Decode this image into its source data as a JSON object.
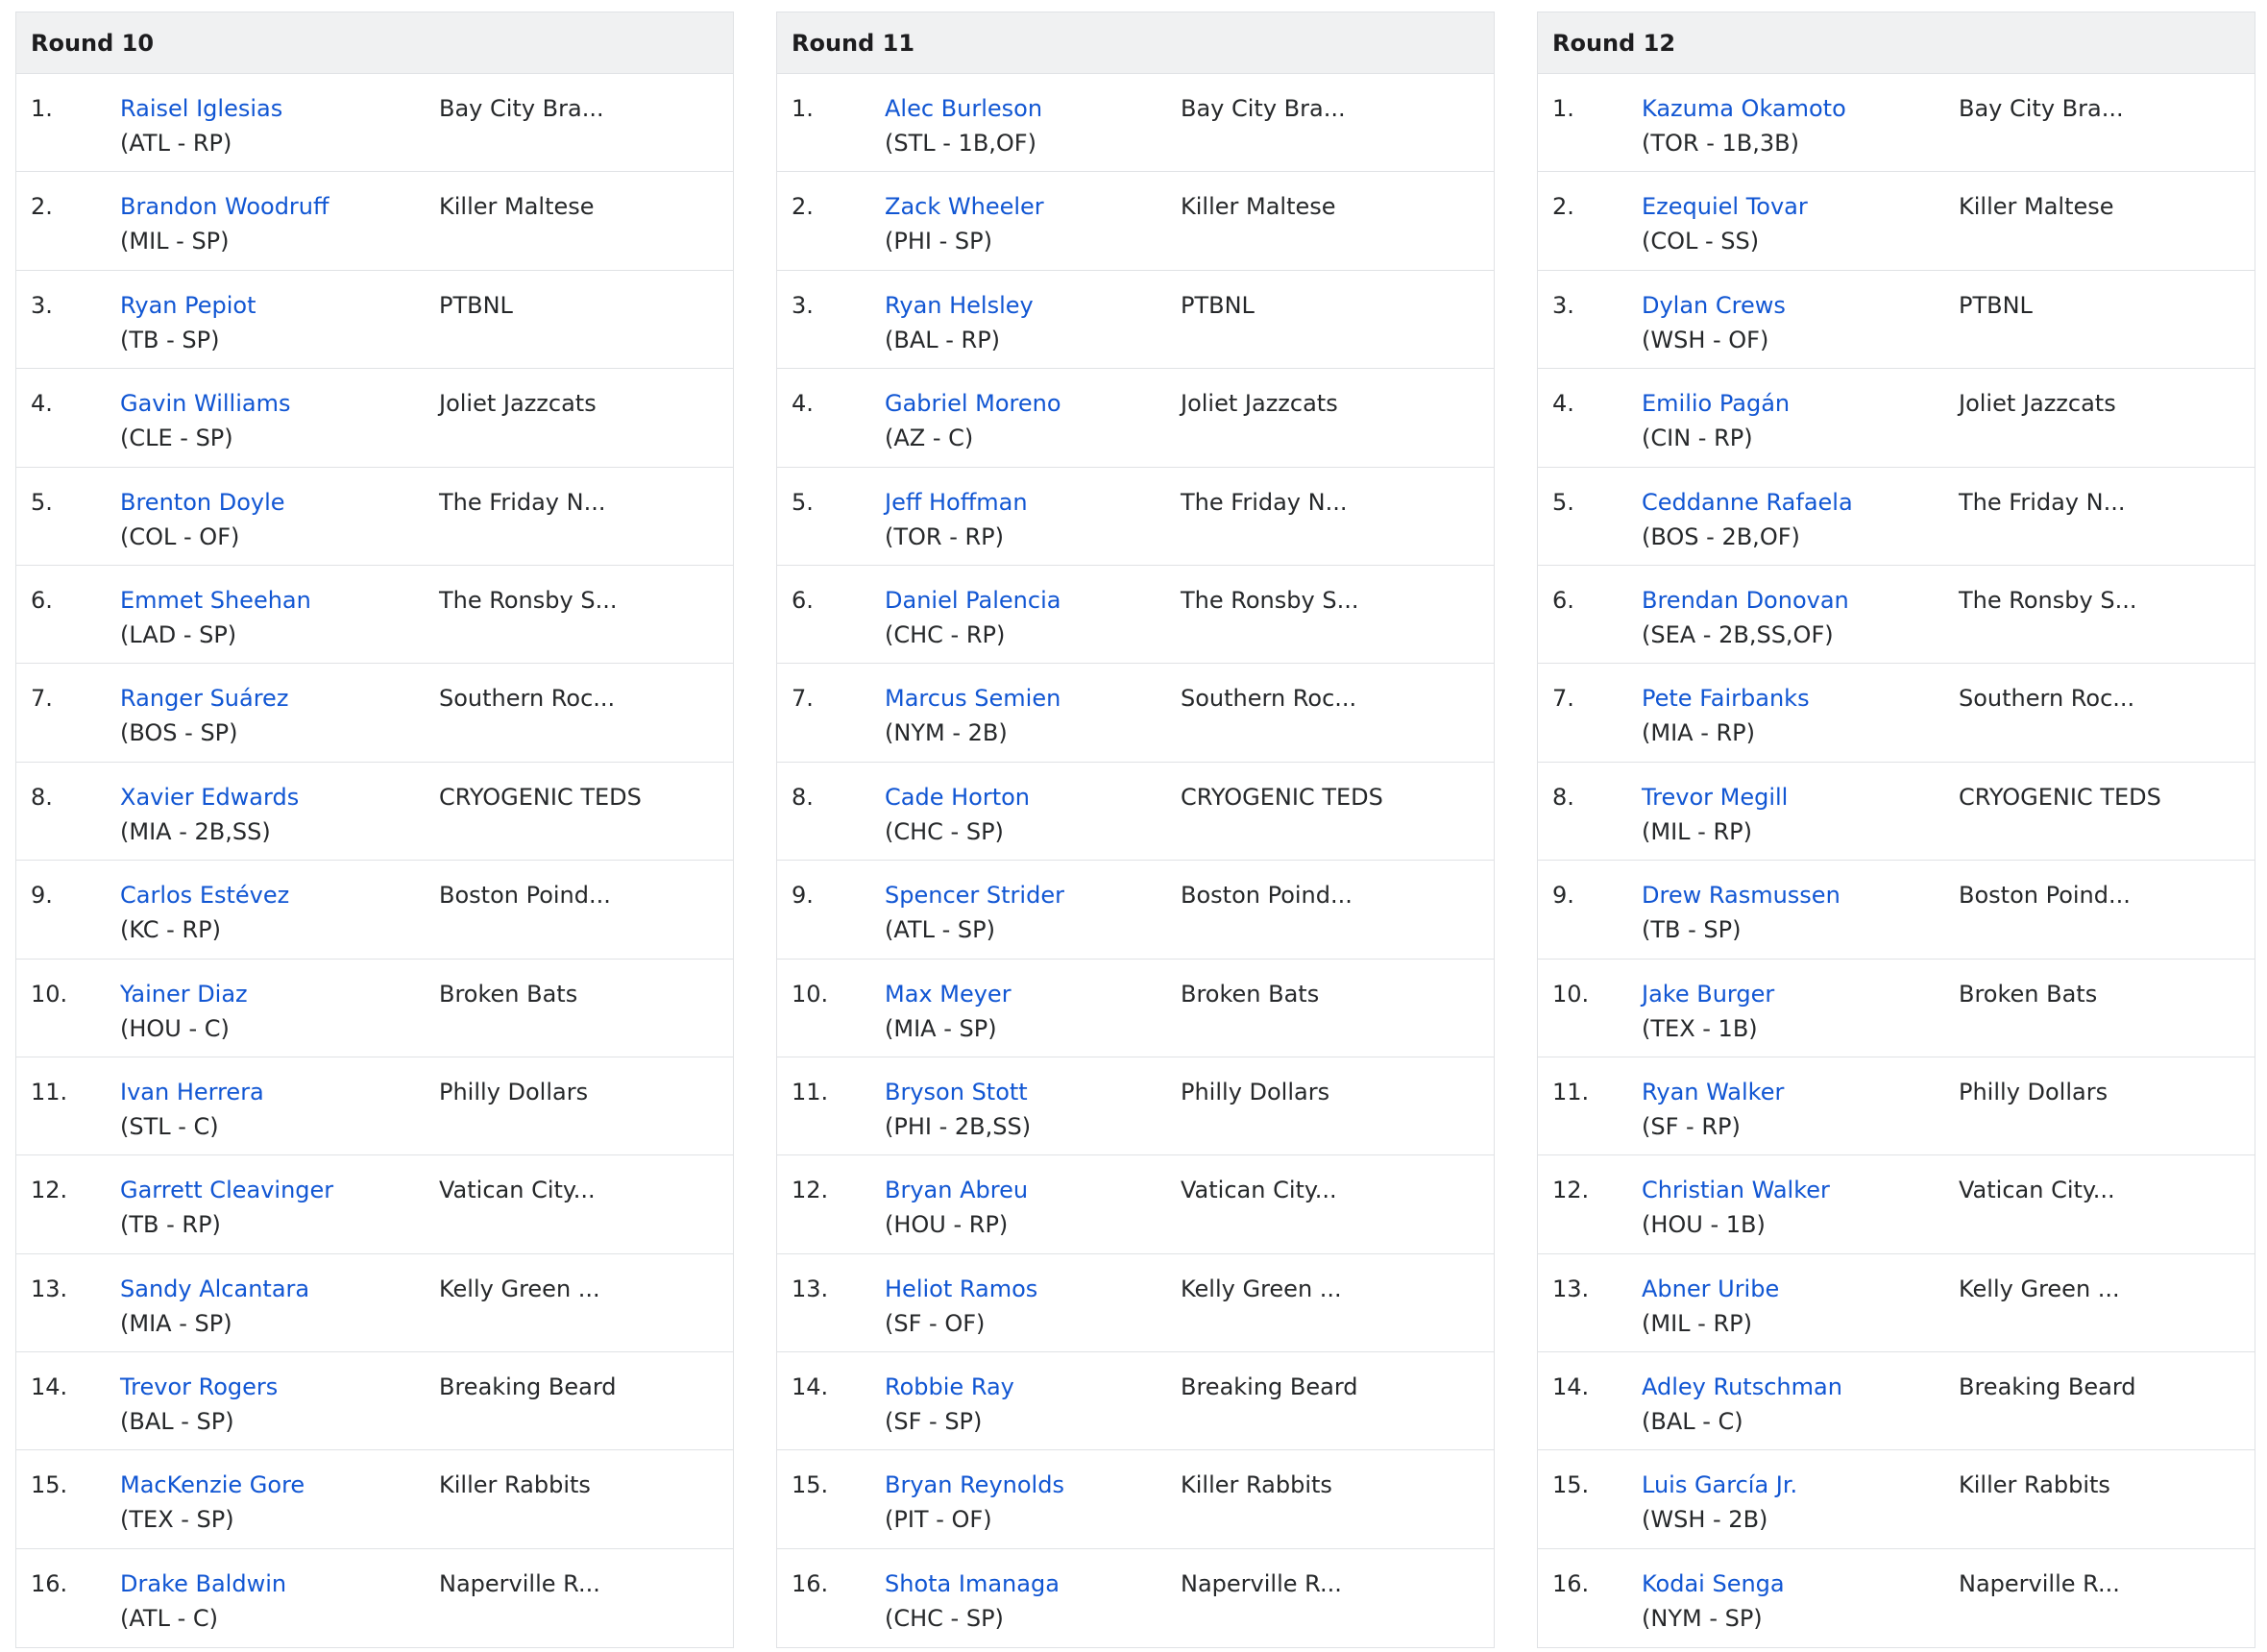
{
  "rounds": [
    {
      "title": "Round 10",
      "picks": [
        {
          "num": "1.",
          "player": "Raisel Iglesias",
          "meta": "(ATL - RP)",
          "team": "Bay City Bra..."
        },
        {
          "num": "2.",
          "player": "Brandon Woodruff",
          "meta": "(MIL - SP)",
          "team": "Killer Maltese"
        },
        {
          "num": "3.",
          "player": "Ryan Pepiot",
          "meta": "(TB - SP)",
          "team": "PTBNL"
        },
        {
          "num": "4.",
          "player": "Gavin Williams",
          "meta": "(CLE - SP)",
          "team": "Joliet Jazzcats"
        },
        {
          "num": "5.",
          "player": "Brenton Doyle",
          "meta": "(COL - OF)",
          "team": "The Friday N..."
        },
        {
          "num": "6.",
          "player": "Emmet Sheehan",
          "meta": "(LAD - SP)",
          "team": "The Ronsby S..."
        },
        {
          "num": "7.",
          "player": "Ranger Suárez",
          "meta": "(BOS - SP)",
          "team": "Southern Roc..."
        },
        {
          "num": "8.",
          "player": "Xavier Edwards",
          "meta": "(MIA - 2B,SS)",
          "team": "CRYOGENIC TEDS"
        },
        {
          "num": "9.",
          "player": "Carlos Estévez",
          "meta": "(KC - RP)",
          "team": "Boston Poind..."
        },
        {
          "num": "10.",
          "player": "Yainer Diaz",
          "meta": "(HOU - C)",
          "team": "Broken Bats"
        },
        {
          "num": "11.",
          "player": "Ivan Herrera",
          "meta": "(STL - C)",
          "team": "Philly Dollars"
        },
        {
          "num": "12.",
          "player": "Garrett Cleavinger",
          "meta": "(TB - RP)",
          "team": "Vatican City..."
        },
        {
          "num": "13.",
          "player": "Sandy Alcantara",
          "meta": "(MIA - SP)",
          "team": "Kelly Green ..."
        },
        {
          "num": "14.",
          "player": "Trevor Rogers",
          "meta": "(BAL - SP)",
          "team": "Breaking Beard"
        },
        {
          "num": "15.",
          "player": "MacKenzie Gore",
          "meta": "(TEX - SP)",
          "team": "Killer Rabbits"
        },
        {
          "num": "16.",
          "player": "Drake Baldwin",
          "meta": "(ATL - C)",
          "team": "Naperville R..."
        }
      ]
    },
    {
      "title": "Round 11",
      "picks": [
        {
          "num": "1.",
          "player": "Alec Burleson",
          "meta": "(STL - 1B,OF)",
          "team": "Bay City Bra..."
        },
        {
          "num": "2.",
          "player": "Zack Wheeler",
          "meta": "(PHI - SP)",
          "team": "Killer Maltese"
        },
        {
          "num": "3.",
          "player": "Ryan Helsley",
          "meta": "(BAL - RP)",
          "team": "PTBNL"
        },
        {
          "num": "4.",
          "player": "Gabriel Moreno",
          "meta": "(AZ - C)",
          "team": "Joliet Jazzcats"
        },
        {
          "num": "5.",
          "player": "Jeff Hoffman",
          "meta": "(TOR - RP)",
          "team": "The Friday N..."
        },
        {
          "num": "6.",
          "player": "Daniel Palencia",
          "meta": "(CHC - RP)",
          "team": "The Ronsby S..."
        },
        {
          "num": "7.",
          "player": "Marcus Semien",
          "meta": "(NYM - 2B)",
          "team": "Southern Roc..."
        },
        {
          "num": "8.",
          "player": "Cade Horton",
          "meta": "(CHC - SP)",
          "team": "CRYOGENIC TEDS"
        },
        {
          "num": "9.",
          "player": "Spencer Strider",
          "meta": "(ATL - SP)",
          "team": "Boston Poind..."
        },
        {
          "num": "10.",
          "player": "Max Meyer",
          "meta": "(MIA - SP)",
          "team": "Broken Bats"
        },
        {
          "num": "11.",
          "player": "Bryson Stott",
          "meta": "(PHI - 2B,SS)",
          "team": "Philly Dollars"
        },
        {
          "num": "12.",
          "player": "Bryan Abreu",
          "meta": "(HOU - RP)",
          "team": "Vatican City..."
        },
        {
          "num": "13.",
          "player": "Heliot Ramos",
          "meta": "(SF - OF)",
          "team": "Kelly Green ..."
        },
        {
          "num": "14.",
          "player": "Robbie Ray",
          "meta": "(SF - SP)",
          "team": "Breaking Beard"
        },
        {
          "num": "15.",
          "player": "Bryan Reynolds",
          "meta": "(PIT - OF)",
          "team": "Killer Rabbits"
        },
        {
          "num": "16.",
          "player": "Shota Imanaga",
          "meta": "(CHC - SP)",
          "team": "Naperville R..."
        }
      ]
    },
    {
      "title": "Round 12",
      "picks": [
        {
          "num": "1.",
          "player": "Kazuma Okamoto",
          "meta": "(TOR - 1B,3B)",
          "team": "Bay City Bra..."
        },
        {
          "num": "2.",
          "player": "Ezequiel Tovar",
          "meta": "(COL - SS)",
          "team": "Killer Maltese"
        },
        {
          "num": "3.",
          "player": "Dylan Crews",
          "meta": "(WSH - OF)",
          "team": "PTBNL"
        },
        {
          "num": "4.",
          "player": "Emilio Pagán",
          "meta": "(CIN - RP)",
          "team": "Joliet Jazzcats"
        },
        {
          "num": "5.",
          "player": "Ceddanne Rafaela",
          "meta": "(BOS - 2B,OF)",
          "team": "The Friday N..."
        },
        {
          "num": "6.",
          "player": "Brendan Donovan",
          "meta": "(SEA - 2B,SS,OF)",
          "team": "The Ronsby S..."
        },
        {
          "num": "7.",
          "player": "Pete Fairbanks",
          "meta": "(MIA - RP)",
          "team": "Southern Roc..."
        },
        {
          "num": "8.",
          "player": "Trevor Megill",
          "meta": "(MIL - RP)",
          "team": "CRYOGENIC TEDS"
        },
        {
          "num": "9.",
          "player": "Drew Rasmussen",
          "meta": "(TB - SP)",
          "team": "Boston Poind..."
        },
        {
          "num": "10.",
          "player": "Jake Burger",
          "meta": "(TEX - 1B)",
          "team": "Broken Bats"
        },
        {
          "num": "11.",
          "player": "Ryan Walker",
          "meta": "(SF - RP)",
          "team": "Philly Dollars"
        },
        {
          "num": "12.",
          "player": "Christian Walker",
          "meta": "(HOU - 1B)",
          "team": "Vatican City..."
        },
        {
          "num": "13.",
          "player": "Abner Uribe",
          "meta": "(MIL - RP)",
          "team": "Kelly Green ..."
        },
        {
          "num": "14.",
          "player": "Adley Rutschman",
          "meta": "(BAL - C)",
          "team": "Breaking Beard"
        },
        {
          "num": "15.",
          "player": "Luis García Jr.",
          "meta": "(WSH - 2B)",
          "team": "Killer Rabbits"
        },
        {
          "num": "16.",
          "player": "Kodai Senga",
          "meta": "(NYM - SP)",
          "team": "Naperville R..."
        }
      ]
    }
  ]
}
